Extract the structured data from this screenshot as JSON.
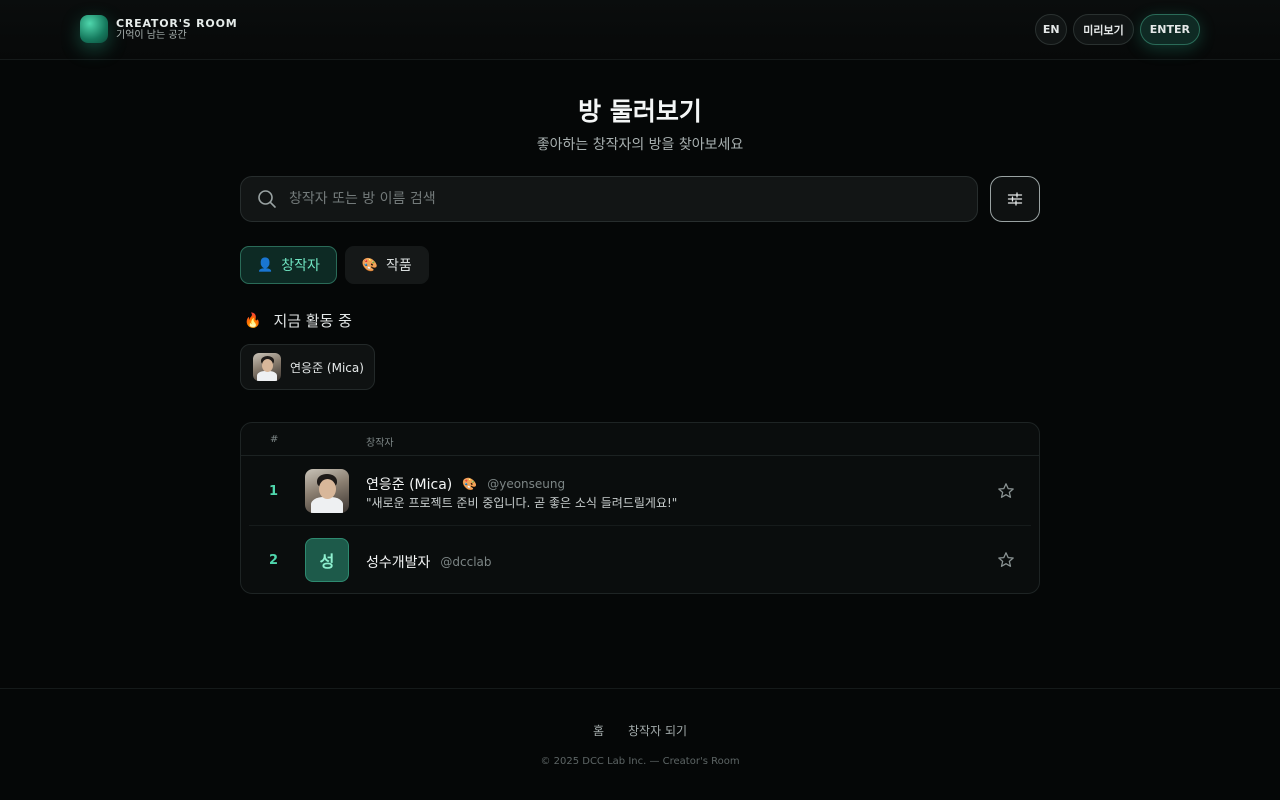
{
  "header": {
    "logo_title": "CREATOR'S ROOM",
    "logo_subtitle": "기억이 남는 공간",
    "lang_button": "EN",
    "preview_button": "미리보기",
    "enter_button": "ENTER"
  },
  "hero": {
    "title": "방 둘러보기",
    "subtitle": "좋아하는 창작자의 방을 찾아보세요"
  },
  "search": {
    "placeholder": "창작자 또는 방 이름 검색",
    "value": ""
  },
  "tabs": [
    {
      "label": "창작자",
      "icon": "person-icon",
      "active": true
    },
    {
      "label": "작품",
      "icon": "palette-icon",
      "active": false
    }
  ],
  "active_now": {
    "title": "지금 활동 중",
    "icon": "fire-icon",
    "users": [
      {
        "name": "연응준 (Mica)"
      }
    ]
  },
  "table": {
    "columns": [
      "#",
      "창작자"
    ],
    "rows": [
      {
        "rank": "1",
        "name": "연응준 (Mica)",
        "badge_icon": "palette-icon",
        "handle": "@yeonseung",
        "bio": "\"새로운 프로젝트 준비 중입니다. 곧 좋은 소식 들려드릴게요!\"",
        "avatar": "photo"
      },
      {
        "rank": "2",
        "name": "성수개발자",
        "handle": "@dcclab",
        "avatar_letter": "성"
      }
    ]
  },
  "footer": {
    "links": [
      "홈",
      "창작자 되기"
    ],
    "copyright": "© 2025 DCC Lab Inc. — Creator's Room"
  },
  "colors": {
    "accent": "#4fd6ac",
    "background": "#050707",
    "accent_dark": "#0d2a24"
  }
}
